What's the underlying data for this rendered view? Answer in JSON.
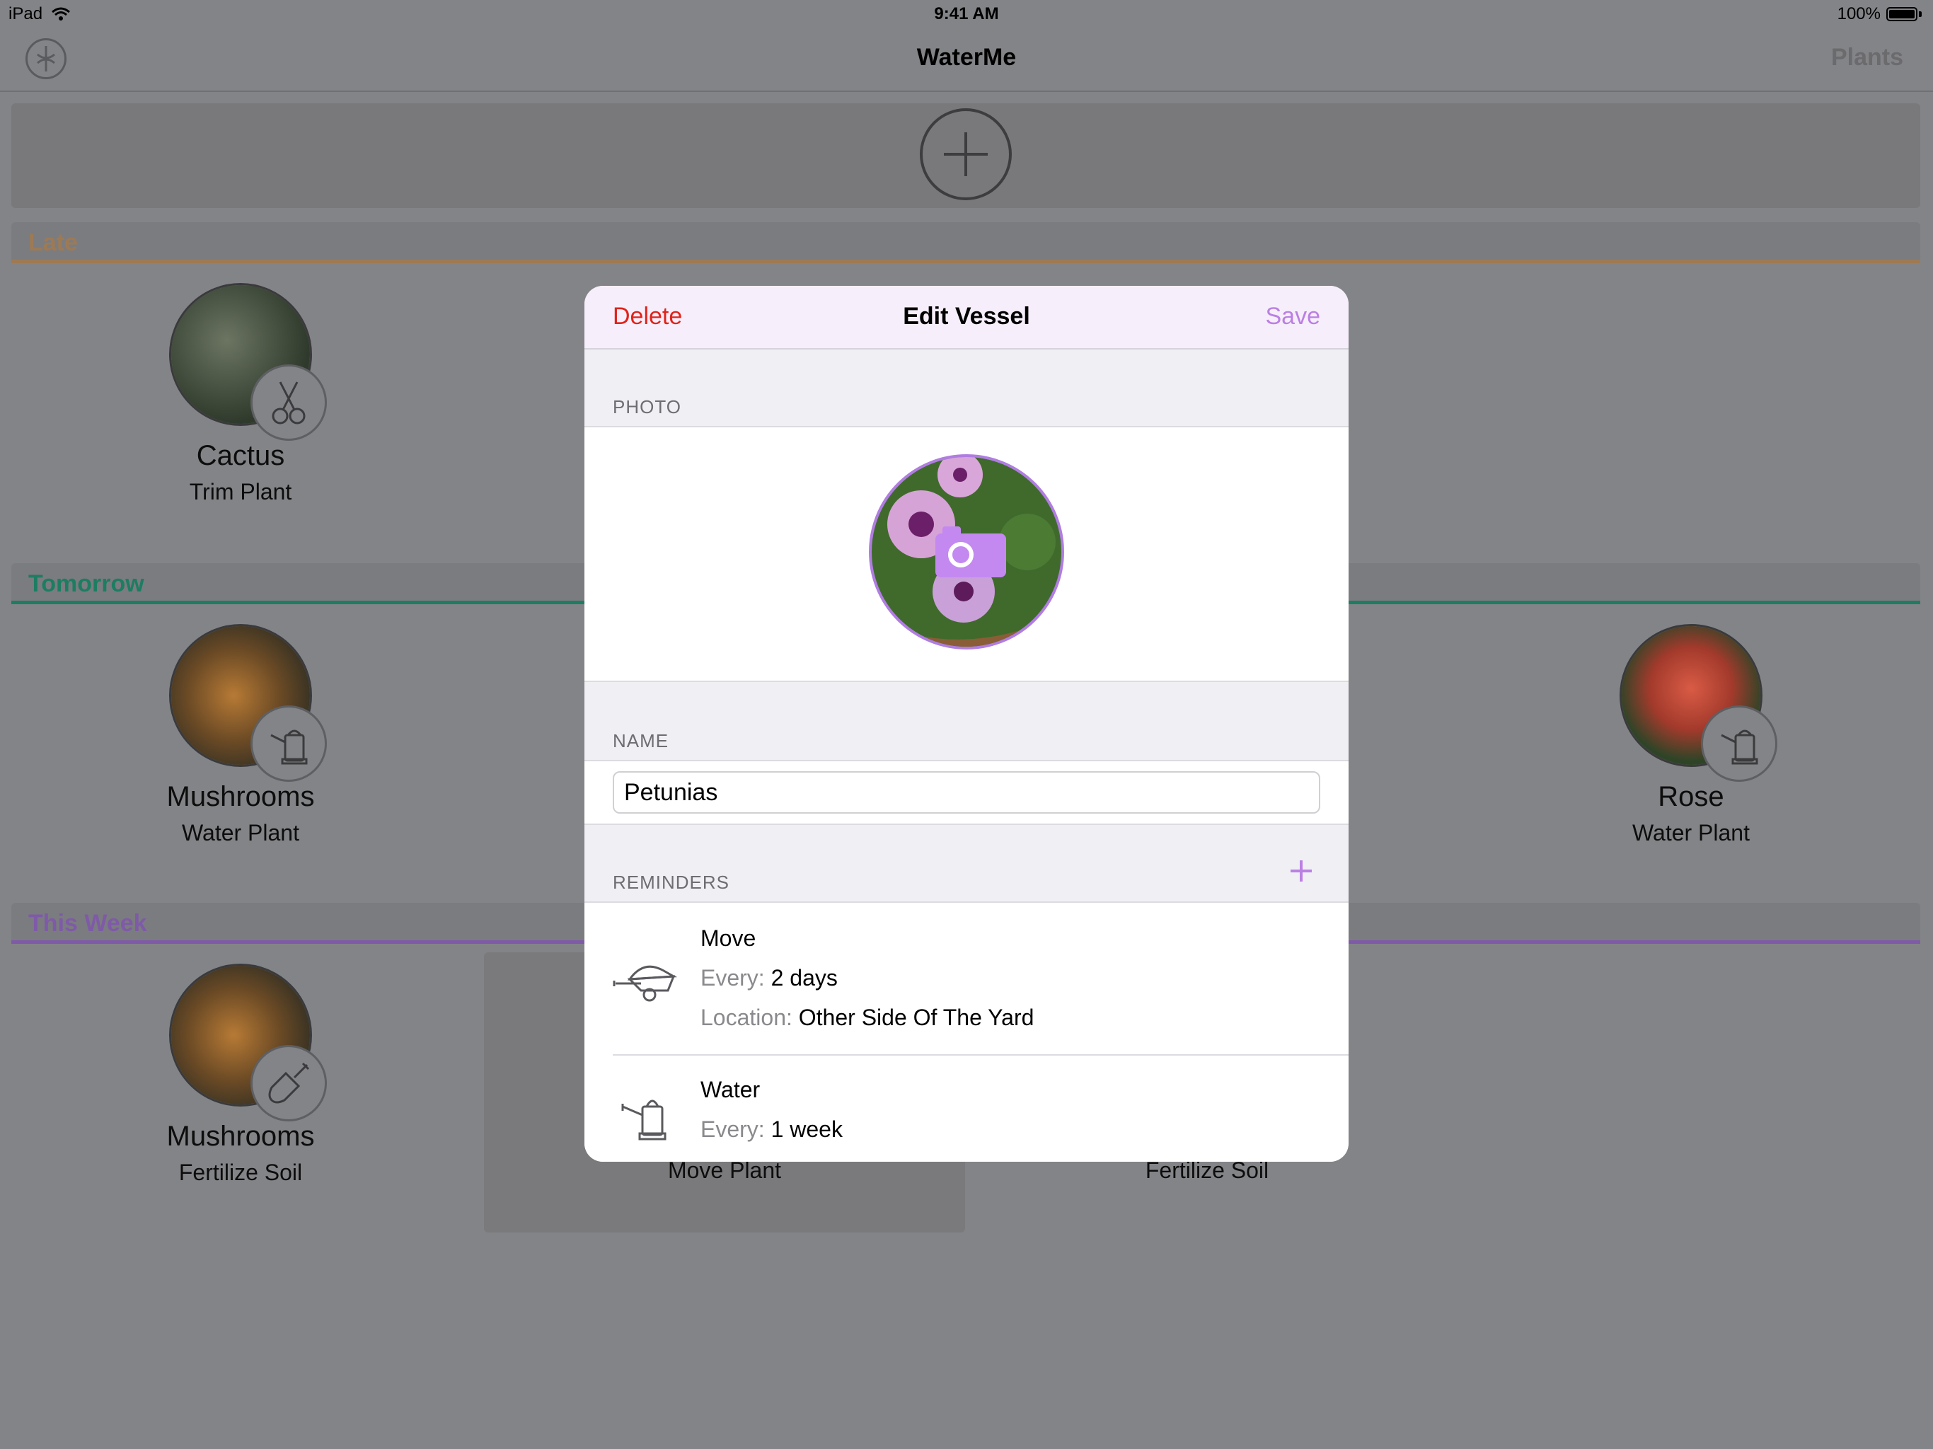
{
  "status_bar": {
    "device": "iPad",
    "time": "9:41 AM",
    "battery": "100%"
  },
  "nav": {
    "title": "WaterMe",
    "right_button": "Plants",
    "left_icon": "settings-logo-icon"
  },
  "sections": {
    "late": {
      "title": "Late",
      "color": "#b7854f"
    },
    "tomorrow": {
      "title": "Tomorrow",
      "color": "#1fa27f"
    },
    "this_week": {
      "title": "This Week",
      "color": "#a070d3"
    }
  },
  "plants": {
    "cactus": {
      "name": "Cactus",
      "task": "Trim Plant"
    },
    "mushrooms1": {
      "name": "Mushrooms",
      "task": "Water Plant"
    },
    "rose": {
      "name": "Rose",
      "task": "Water Plant"
    },
    "mushrooms2": {
      "name": "Mushrooms",
      "task": "Fertilize Soil"
    },
    "move_plant": {
      "task": "Move Plant"
    },
    "fertilize_soil": {
      "task": "Fertilize Soil"
    }
  },
  "modal": {
    "delete_label": "Delete",
    "title": "Edit Vessel",
    "save_label": "Save",
    "photo_label": "PHOTO",
    "name_label": "NAME",
    "name_value": "Petunias",
    "reminders_label": "REMINDERS",
    "reminders": [
      {
        "title": "Move",
        "every_key": "Every:",
        "every_value": "2 days",
        "location_key": "Location:",
        "location_value": "Other Side Of The Yard",
        "icon": "wheelbarrow-icon"
      },
      {
        "title": "Water",
        "every_key": "Every:",
        "every_value": "1 week",
        "icon": "watering-can-icon"
      }
    ]
  },
  "colors": {
    "accent": "#bb80e3",
    "delete": "#e0231b",
    "dim_overlay": "#838487"
  }
}
